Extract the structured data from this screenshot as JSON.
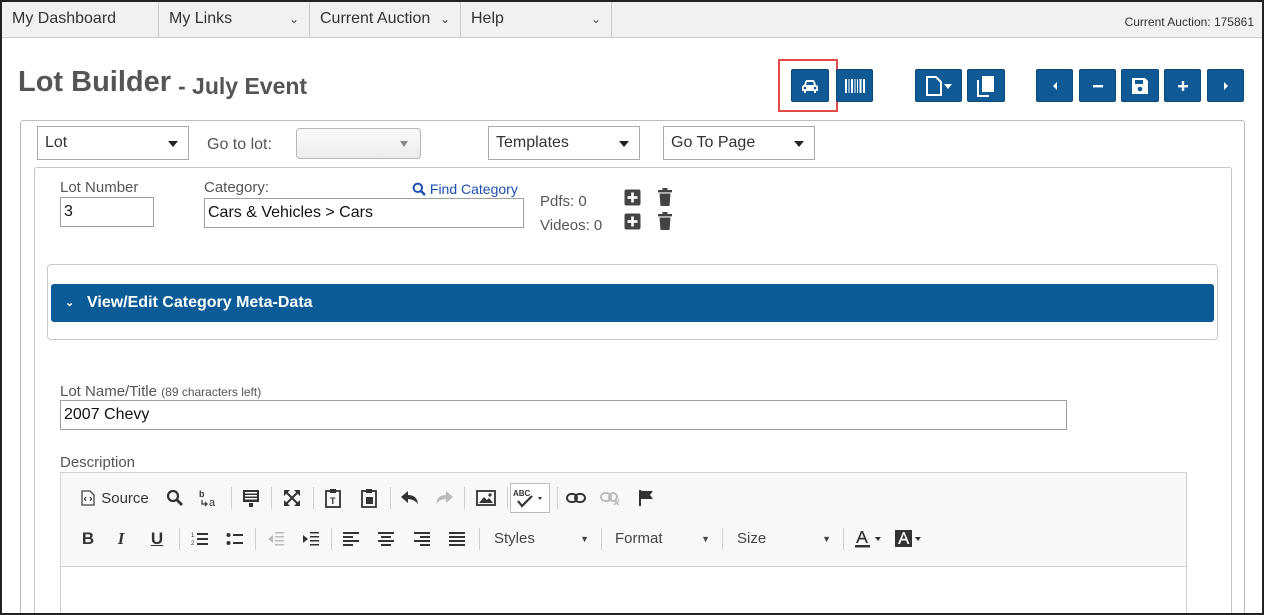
{
  "menu": {
    "dashboard": "My Dashboard",
    "links": "My Links",
    "current_auction": "Current Auction",
    "help": "Help",
    "current_auction_status": "Current Auction: 175861"
  },
  "header": {
    "title": "Lot Builder",
    "subtitle": "- July Event"
  },
  "toolbar_icons": [
    "car-icon",
    "barcode-icon",
    "new-file-icon",
    "copy-icon",
    "prev-icon",
    "minus-icon",
    "save-icon",
    "plus-icon",
    "next-icon"
  ],
  "filters": {
    "lot_select": "Lot",
    "goto_label": "Go to lot:",
    "goto_value": "",
    "templates": "Templates",
    "goto_page": "Go To Page"
  },
  "lot": {
    "number_label": "Lot Number",
    "number_value": "3",
    "category_label": "Category:",
    "find_category": "Find Category",
    "category_value": "Cars & Vehicles > Cars",
    "pdfs": "Pdfs: 0",
    "videos": "Videos: 0"
  },
  "meta": {
    "label": "View/Edit Category Meta-Data"
  },
  "title_field": {
    "label": "Lot Name/Title",
    "chars_left": "(89 characters left)",
    "value": "2007 Chevy"
  },
  "description": {
    "label": "Description",
    "source": "Source",
    "styles": "Styles",
    "format": "Format",
    "size": "Size",
    "bold": "B",
    "italic": "I",
    "underline": "U",
    "spell": "ABC"
  },
  "colors": {
    "primary": "#0f5a94",
    "highlight": "#e24a4a"
  }
}
